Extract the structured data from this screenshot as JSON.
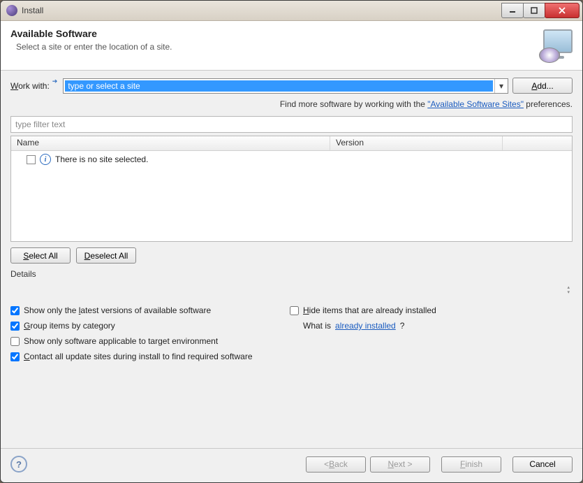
{
  "window": {
    "title": "Install"
  },
  "header": {
    "title": "Available Software",
    "subtitle": "Select a site or enter the location of a site."
  },
  "workWith": {
    "label": "Work with:",
    "placeholder": "type or select a site",
    "addButton": "Add..."
  },
  "hint": {
    "prefix": "Find more software by working with the ",
    "link": "\"Available Software Sites\"",
    "suffix": " preferences."
  },
  "filter": {
    "placeholder": "type filter text"
  },
  "table": {
    "cols": {
      "name": "Name",
      "version": "Version"
    },
    "emptyMsg": "There is no site selected."
  },
  "buttons": {
    "selectAll": "Select All",
    "deselectAll": "Deselect All",
    "back": "< Back",
    "next": "Next >",
    "finish": "Finish",
    "cancel": "Cancel"
  },
  "details": {
    "label": "Details"
  },
  "options": {
    "latest": "Show only the latest versions of available software",
    "group": "Group items by category",
    "target": "Show only software applicable to target environment",
    "contact": "Contact all update sites during install to find required software",
    "hide": "Hide items that are already installed",
    "whatIsPrefix": "What is ",
    "whatIsLink": "already installed",
    "whatIsSuffix": "?"
  }
}
